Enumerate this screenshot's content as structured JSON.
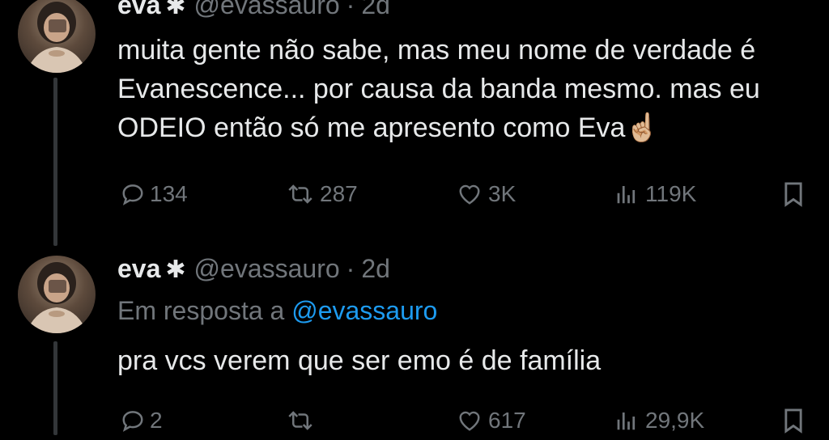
{
  "colors": {
    "background": "#000000",
    "text": "#e7e9ea",
    "muted": "#71767b",
    "link": "#1d9bf0",
    "thread_line": "#333639"
  },
  "tweets": [
    {
      "author": {
        "name": "eva",
        "badge": "✱",
        "handle": "@evassauro",
        "separator": "·",
        "time": "2d"
      },
      "lines": [
        "muita gente não sabe, mas meu nome de verdade é",
        "Evanescence... por causa da banda mesmo. mas eu",
        "ODEIO então só me apresento como Eva☝🏼"
      ],
      "actions": {
        "replies": "134",
        "retweets": "287",
        "likes": "3K",
        "views": "119K"
      }
    },
    {
      "author": {
        "name": "eva",
        "badge": "✱",
        "handle": "@evassauro",
        "separator": "·",
        "time": "2d"
      },
      "reply_to": {
        "prefix": "Em resposta a",
        "mention": "@evassauro"
      },
      "lines": [
        "pra vcs verem que ser emo é de família"
      ],
      "actions": {
        "replies": "2",
        "retweets": "",
        "likes": "617",
        "views": "29,9K"
      }
    }
  ],
  "icons": {
    "reply": "reply-bubble-icon",
    "retweet": "retweet-arrows-icon",
    "like": "heart-icon",
    "views": "views-bar-chart-icon",
    "bookmark": "bookmark-icon"
  }
}
